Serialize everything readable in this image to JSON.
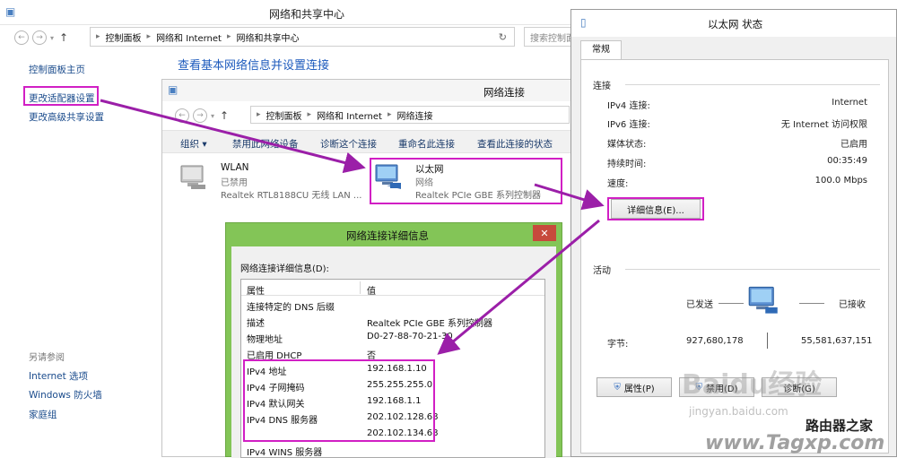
{
  "main": {
    "title": "网络和共享中心",
    "breadcrumb": [
      "控制面板",
      "网络和 Internet",
      "网络和共享中心"
    ],
    "search_placeholder": "搜索控制面",
    "left_nav": [
      "控制面板主页",
      "更改适配器设置",
      "更改高级共享设置"
    ],
    "see_also_title": "另请参阅",
    "see_also": [
      "Internet 选项",
      "Windows 防火墙",
      "家庭组"
    ],
    "heading": "查看基本网络信息并设置连接"
  },
  "netwin": {
    "title": "网络连接",
    "breadcrumb": [
      "控制面板",
      "网络和 Internet",
      "网络连接"
    ],
    "commands": [
      "组织 ▾",
      "禁用此网络设备",
      "诊断这个连接",
      "重命名此连接",
      "查看此连接的状态"
    ],
    "adapters": [
      {
        "name": "WLAN",
        "status": "已禁用",
        "device": "Realtek RTL8188CU 无线 LAN ..."
      },
      {
        "name": "以太网",
        "status": "网络",
        "device": "Realtek PCIe GBE 系列控制器"
      }
    ]
  },
  "details": {
    "title": "网络连接详细信息",
    "close": "✕",
    "label": "网络连接详细信息(D):",
    "columns": [
      "属性",
      "值"
    ],
    "rows": [
      [
        "连接特定的 DNS 后缀",
        ""
      ],
      [
        "描述",
        "Realtek PCIe GBE 系列控制器"
      ],
      [
        "物理地址",
        "D0-27-88-70-21-30"
      ],
      [
        "已启用 DHCP",
        "否"
      ],
      [
        "IPv4 地址",
        "192.168.1.10"
      ],
      [
        "IPv4 子网掩码",
        "255.255.255.0"
      ],
      [
        "IPv4 默认网关",
        "192.168.1.1"
      ],
      [
        "IPv4 DNS 服务器",
        "202.102.128.68"
      ],
      [
        "",
        "202.102.134.68"
      ],
      [
        "IPv4 WINS 服务器",
        ""
      ]
    ]
  },
  "status": {
    "title": "以太网 状态",
    "tab": "常规",
    "connection_title": "连接",
    "rows": [
      [
        "IPv4 连接:",
        "Internet"
      ],
      [
        "IPv6 连接:",
        "无 Internet 访问权限"
      ],
      [
        "媒体状态:",
        "已启用"
      ],
      [
        "持续时间:",
        "00:35:49"
      ],
      [
        "速度:",
        "100.0 Mbps"
      ]
    ],
    "details_button": "详细信息(E)...",
    "activity_title": "活动",
    "sent_label": "已发送",
    "received_label": "已接收",
    "bytes_label": "字节:",
    "bytes_sent": "927,680,178",
    "bytes_received": "55,581,637,151",
    "buttons": [
      "属性(P)",
      "禁用(D)",
      "诊断(G)"
    ]
  },
  "watermark": {
    "baidu": "Baidu经验",
    "url": "jingyan.baidu.com",
    "site_cn": "路由器之家",
    "site_url": "www.Tagxp.com"
  },
  "colors": {
    "highlight": "#d11fc4",
    "arrow": "#9b1fa8",
    "dialog_green": "#83c557"
  }
}
